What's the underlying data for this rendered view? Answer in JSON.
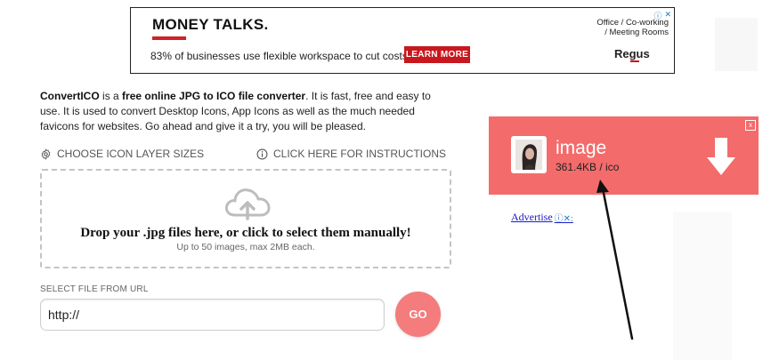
{
  "ad_banner": {
    "headline": "MONEY TALKS.",
    "tagline": "83% of businesses use flexible workspace to cut costs.",
    "cta": "LEARN MORE",
    "office_line1": "Office / Co-working",
    "office_line2": "/ Meeting Rooms",
    "brand": "Regus",
    "adchoice_icons": [
      "info-icon",
      "close-icon"
    ]
  },
  "intro": {
    "app_name": "ConvertICO",
    "text1": " is a ",
    "highlight": "free online JPG to ICO file converter",
    "text2": ". It is fast, free and easy to use. It is used to convert Desktop Icons, App Icons as well as the much needed favicons for websites. Go ahead and give it a try, you will be pleased."
  },
  "options": {
    "layer_sizes": "CHOOSE ICON LAYER SIZES",
    "instructions": "CLICK HERE FOR INSTRUCTIONS"
  },
  "dropzone": {
    "main_text": "Drop your .jpg files here, or click to select them manually!",
    "sub_text": "Up to 50 images, max 2MB each."
  },
  "url": {
    "label": "SELECT FILE FROM URL",
    "value": "http://",
    "go_label": "GO"
  },
  "ad_card": {
    "title": "image",
    "meta": "361.4KB / ico",
    "close_label": "x"
  },
  "advertise": {
    "label": "Advertise",
    "icons": "ⓘ✕:"
  },
  "colors": {
    "ad_red": "#c8181e",
    "card_bg": "#f46b6b",
    "go_btn": "#f47c7c",
    "link": "#1a1ac8"
  }
}
